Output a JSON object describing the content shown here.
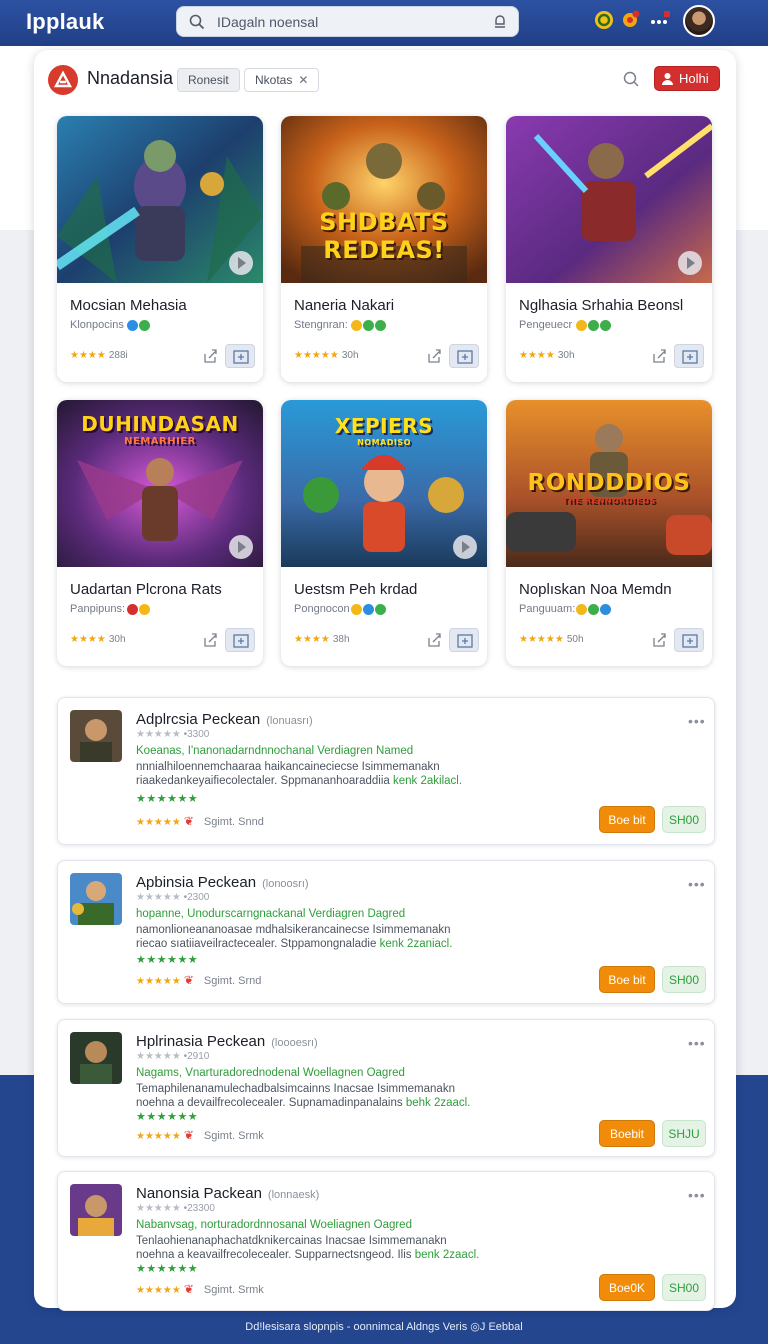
{
  "header": {
    "brand": "Ipplauk",
    "search_placeholder": "IDagaln noensal",
    "icons": [
      "search-icon",
      "mic-icon",
      "coin-icon",
      "notification-icon",
      "more-icon"
    ]
  },
  "panel": {
    "title": "Nnadansia",
    "chip_filter": "Ronesit",
    "chip_tag": "Nkotas",
    "chip_tag_close": "✕",
    "action_button": "Holhi"
  },
  "cards": [
    {
      "title": "Mocsian Mehasia",
      "subtitle": "Klonpocins",
      "rating": "★★★★",
      "count": "288i",
      "badges": [
        "#2b8ee0",
        "#3cae4a"
      ]
    },
    {
      "title": "Naneria Nakari",
      "subtitle": "Stengnran:",
      "rating": "★★★★★",
      "count": "30h",
      "badges": [
        "#f2b81a",
        "#3cae4a",
        "#3cae4a"
      ]
    },
    {
      "title": "Nglhasia  Srhahia Beonsl",
      "subtitle": "Pengeuecr",
      "rating": "★★★★",
      "count": "30h",
      "badges": [
        "#f2b81a",
        "#3cae4a",
        "#3cae4a"
      ]
    },
    {
      "title": "Uadartan Plcrona Rats",
      "subtitle": "Panpipuns:",
      "rating": "★★★★",
      "count": "30h",
      "badges": [
        "#d32f2f",
        "#f2b81a"
      ]
    },
    {
      "title": "Uestsm Peh krdad",
      "subtitle": "Pongnocon",
      "rating": "★★★★",
      "count": "38h",
      "badges": [
        "#f2b81a",
        "#2b8ee0",
        "#3cae4a"
      ]
    },
    {
      "title": "Noplıskan Noa Memdn",
      "subtitle": "Panguuam:",
      "rating": "★★★★★",
      "count": "50h",
      "badges": [
        "#f2b81a",
        "#3cae4a",
        "#2b8ee0"
      ]
    }
  ],
  "art_titles": {
    "card2": [
      "SHDBATS",
      "REDEAS!"
    ],
    "card4": [
      "DUHINDASAN",
      "NEMARHIER"
    ],
    "card5": [
      "XEPIERS",
      "NOMADISO"
    ],
    "card6": [
      "RONDDDIOS",
      "THE RENNORDIEDS"
    ]
  },
  "list": [
    {
      "title": "Adplrcsia Peckean",
      "tag": "(lonuasrı)",
      "meta_stars": "★★★★★",
      "meta_count": "•3300",
      "green": "Koeanas, I'nanonadarndnnochanal Verdiagren Named",
      "desc1": "nnnialhiloennemchaaraa haikancaineciecse Isimmemanakn",
      "desc2_a": "riaakedankeyaifiecolectaler. Sppmananhoaraddiia ",
      "desc2_hl": "kenk 2akilacl.",
      "gstars": "★★★★★★",
      "bottom_stars": "★★★★★",
      "spon": "Sgimt. Snnd",
      "btn1": "Boe bit",
      "btn2": "SH00"
    },
    {
      "title": "Apbinsia Peckean",
      "tag": "(lonoosrı)",
      "meta_stars": "★★★★★",
      "meta_count": "•2300",
      "green": "hopanne,  Unodurscarngnackanal Verdiagren Dagred",
      "desc1": "namonlioneananoasae mdhalsikerancainecse Isimmemanakn",
      "desc2_a": "riecao sıatiiaveilractecealer. Stppamongnaladie ",
      "desc2_hl": "kenk 2zaniacl.",
      "gstars": "★★★★★★",
      "bottom_stars": "★★★★★",
      "spon": "Sgimt. Srnd",
      "btn1": "Boe bit",
      "btn2": "SH00"
    },
    {
      "title": "Hplrinasia Peckean",
      "tag": "(loooesrı)",
      "meta_stars": "★★★★★",
      "meta_count": "•2910",
      "green": "Nagams,  Vnarturadorednodenal Woellagnen Oagred",
      "desc1": "Temaphilenanamulechadbalsimcainns Inacsae Isimmemanakn",
      "desc2_a": "noehna a devailfrecolecealer. Supnamadinpanalains ",
      "desc2_hl": "behk 2zaacl.",
      "gstars": "★★★★★★",
      "bottom_stars": "★★★★★",
      "spon": "Sgimt. Srmk",
      "btn1": "Boebit",
      "btn2": "SHJU"
    },
    {
      "title": "Nanonsia Packean",
      "tag": "(lonnaesk)",
      "meta_stars": "★★★★★",
      "meta_count": "•23300",
      "green": "Nabanvsag,  norturadordnnosanal Woeliagnen Oagred",
      "desc1": "Tenlaohienanaphachatdknikercainas Inacsae Isimmemanakn",
      "desc2_a": "noehna a keavailfrecolecealer. Supparnectsngeod. Ilis ",
      "desc2_hl": "benk 2zaacl.",
      "gstars": "★★★★★★",
      "bottom_stars": "★★★★★",
      "spon": "Sgimt. Srmk",
      "btn1": "Boe0K",
      "btn2": "SH00"
    }
  ],
  "footer": "Dd!lesisara slopnpis - oonnimcal Aldngs Veris ◎J Eebbal",
  "colors": {
    "topbar": "#24468f",
    "accent_red": "#d32f2f",
    "accent_orange": "#f08c0a",
    "green": "#2e9e3a",
    "star": "#f2a614"
  }
}
